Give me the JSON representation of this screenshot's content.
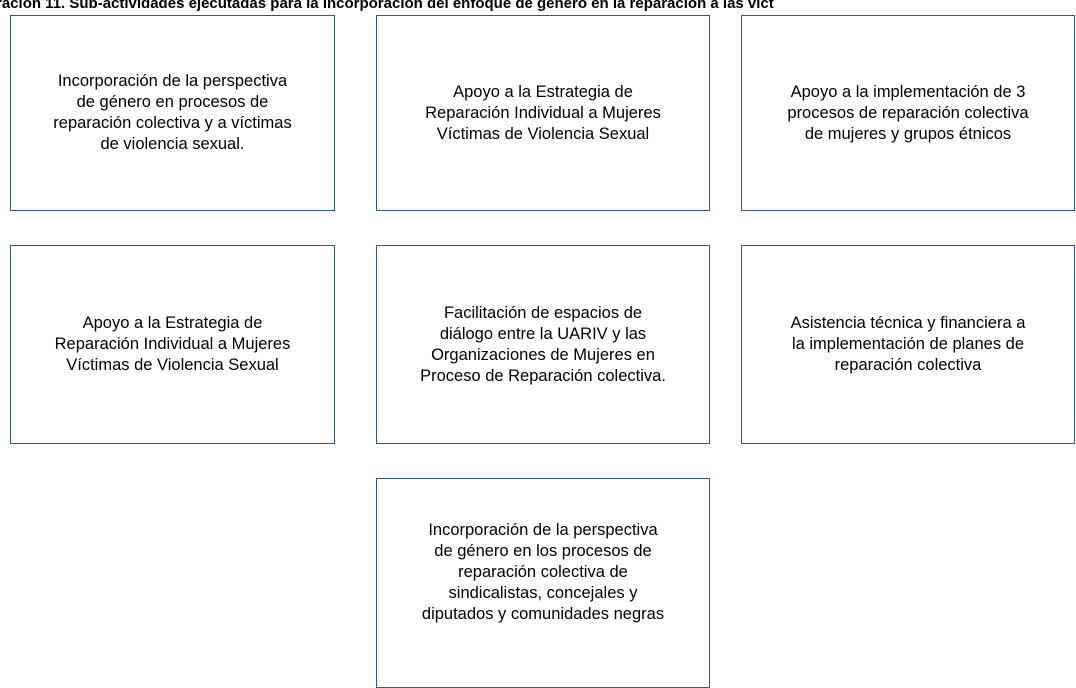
{
  "title": "ración 11. Sub-actividades ejecutadas para la incorporación del enfoque de género en la reparación a las víct",
  "boxes": [
    {
      "text": "Incorporación de la perspectiva\nde género en procesos de\nreparación colectiva y a víctimas\nde violencia sexual."
    },
    {
      "text": "Apoyo a la Estrategia de\nReparación Individual a Mujeres\nVíctimas de Violencia Sexual"
    },
    {
      "text": "Apoyo a la implementación de 3\nprocesos de reparación colectiva\nde mujeres y grupos étnicos"
    },
    {
      "text": "Apoyo a la Estrategia de\nReparación Individual a Mujeres\nVíctimas de Violencia Sexual"
    },
    {
      "text": "Facilitación de espacios de\ndiálogo entre la UARIV y las\nOrganizaciones de Mujeres en\nProceso de Reparación colectiva."
    },
    {
      "text": "Asistencia técnica y financiera a\nla implementación de planes de\nreparación colectiva"
    },
    {
      "text": "Incorporación de la perspectiva\nde género en los procesos de\nreparación colectiva de\nsindicalistas, concejales y\ndiputados y comunidades negras"
    }
  ],
  "colors": {
    "box_border": "#2f5597",
    "text": "#000000",
    "background": "#ffffff"
  }
}
